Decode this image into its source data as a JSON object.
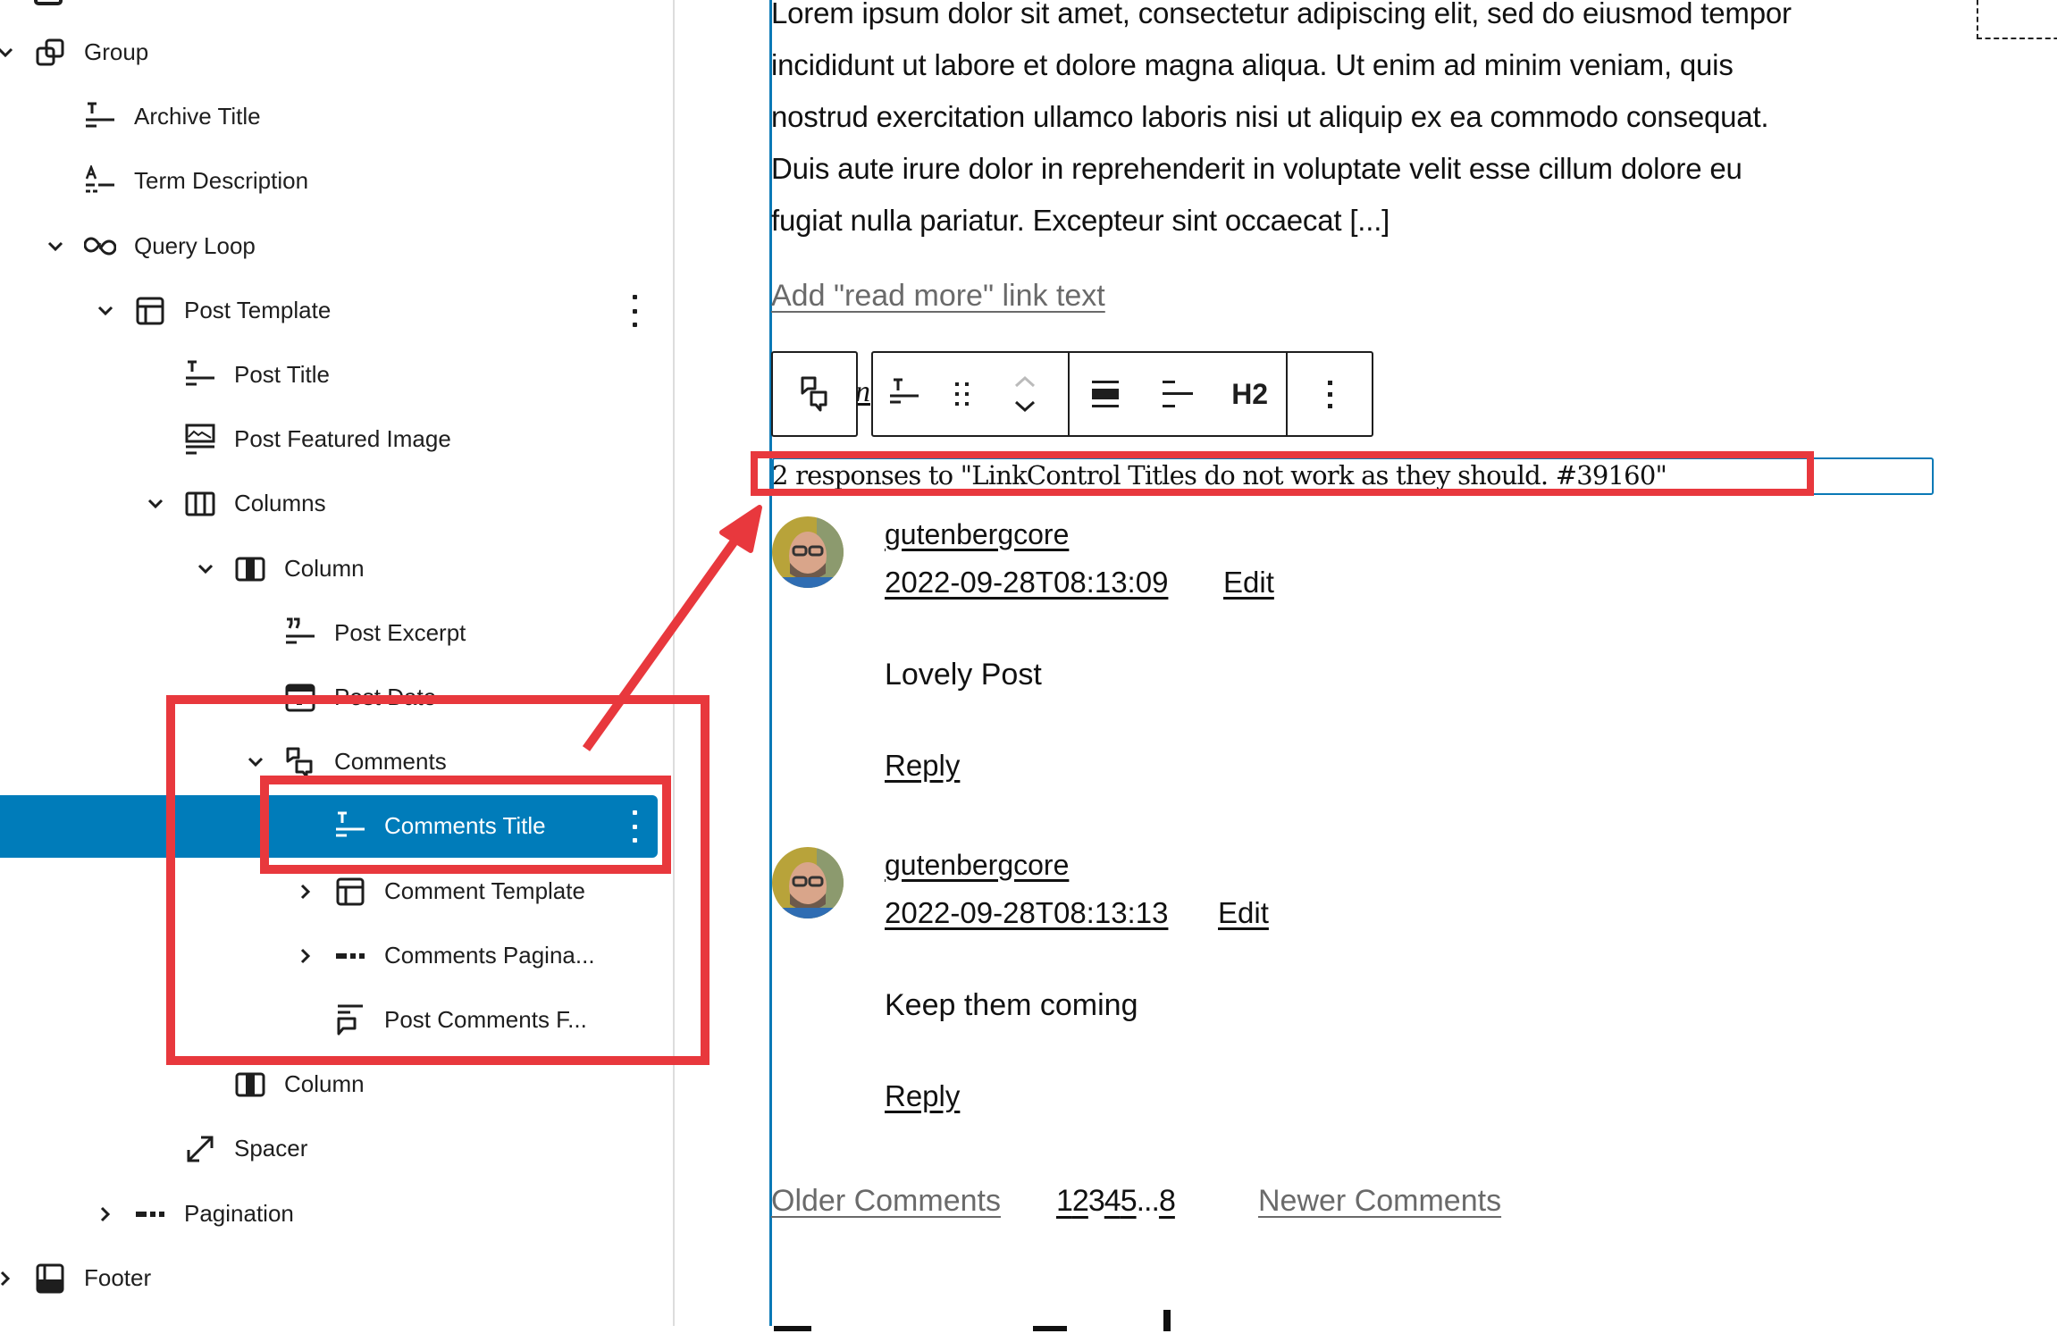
{
  "list_view": {
    "items": [
      {
        "label": "Group",
        "icon": "group-icon",
        "expanded": true,
        "level": 0
      },
      {
        "label": "Archive Title",
        "icon": "title-icon",
        "level": 1
      },
      {
        "label": "Term Description",
        "icon": "term-description-icon",
        "level": 1
      },
      {
        "label": "Query Loop",
        "icon": "loop-icon",
        "expanded": true,
        "level": 1
      },
      {
        "label": "Post Template",
        "icon": "layout-icon",
        "expanded": true,
        "level": 2,
        "has_options": true
      },
      {
        "label": "Post Title",
        "icon": "title-icon",
        "level": 3
      },
      {
        "label": "Post Featured Image",
        "icon": "featured-image-icon",
        "level": 3
      },
      {
        "label": "Columns",
        "icon": "columns-icon",
        "expanded": true,
        "level": 3
      },
      {
        "label": "Column",
        "icon": "column-icon",
        "expanded": true,
        "level": 4
      },
      {
        "label": "Post Excerpt",
        "icon": "excerpt-icon",
        "level": 5
      },
      {
        "label": "Post Date",
        "icon": "calendar-icon",
        "level": 5
      },
      {
        "label": "Comments",
        "icon": "comments-icon",
        "expanded": true,
        "level": 5
      },
      {
        "label": "Comments Title",
        "icon": "title-icon",
        "level": 6,
        "selected": true,
        "has_options": true
      },
      {
        "label": "Comment Template",
        "icon": "layout-icon",
        "expanded": false,
        "level": 6
      },
      {
        "label": "Comments Pagina...",
        "icon": "pagination-icon",
        "expanded": false,
        "level": 6
      },
      {
        "label": "Post Comments F...",
        "icon": "comment-form-icon",
        "level": 6
      },
      {
        "label": "Column",
        "icon": "column-icon",
        "level": 4
      },
      {
        "label": "Spacer",
        "icon": "resize-icon",
        "level": 3
      },
      {
        "label": "Pagination",
        "icon": "pagination-icon",
        "expanded": false,
        "level": 2
      },
      {
        "label": "Footer",
        "icon": "footer-icon",
        "expanded": false,
        "level": 0
      }
    ]
  },
  "canvas": {
    "excerpt_lines": [
      "Lorem ipsum dolor sit amet, consectetur adipiscing elit, sed do eiusmod tempor",
      "incididunt ut labore et dolore magna aliqua. Ut enim ad minim veniam, quis",
      "nostrud exercitation ullamco laboris nisi ut aliquip ex ea commodo consequat.",
      "Duis aute irure dolor in reprehenderit in voluptate velit esse cillum dolore eu",
      "fugiat nulla pariatur. Excepteur sint occaecat [...]"
    ],
    "read_more_placeholder": "Add \"read more\" link text",
    "toolbar": {
      "parent_block": "comments-icon",
      "block_type": "title-icon",
      "drag": "drag-handle-icon",
      "move_up": "chevron-up-icon",
      "move_down": "chevron-down-icon",
      "align": "align-full-icon",
      "justify": "justify-left-icon",
      "heading_level": "H2",
      "options": "more-vertical-icon"
    },
    "comments_title": "2 responses to \"LinkControl Titles do not work as they should. #39160\"",
    "comments": [
      {
        "author": "gutenbergcore",
        "date": "2022-09-28T08:13:09",
        "edit": "Edit",
        "body": "Lovely Post",
        "reply": "Reply"
      },
      {
        "author": "gutenbergcore",
        "date": "2022-09-28T08:13:13",
        "edit": "Edit",
        "body": "Keep them coming",
        "reply": "Reply"
      }
    ],
    "pagination": {
      "previous": "Older Comments",
      "pages": [
        "1",
        "2",
        "3",
        "4",
        "5",
        "...",
        "8"
      ],
      "current_page": "3",
      "next": "Newer Comments"
    }
  },
  "colors": {
    "selection": "#007cba",
    "annotation": "#e8383d",
    "block_outline": "#0a79b6"
  }
}
